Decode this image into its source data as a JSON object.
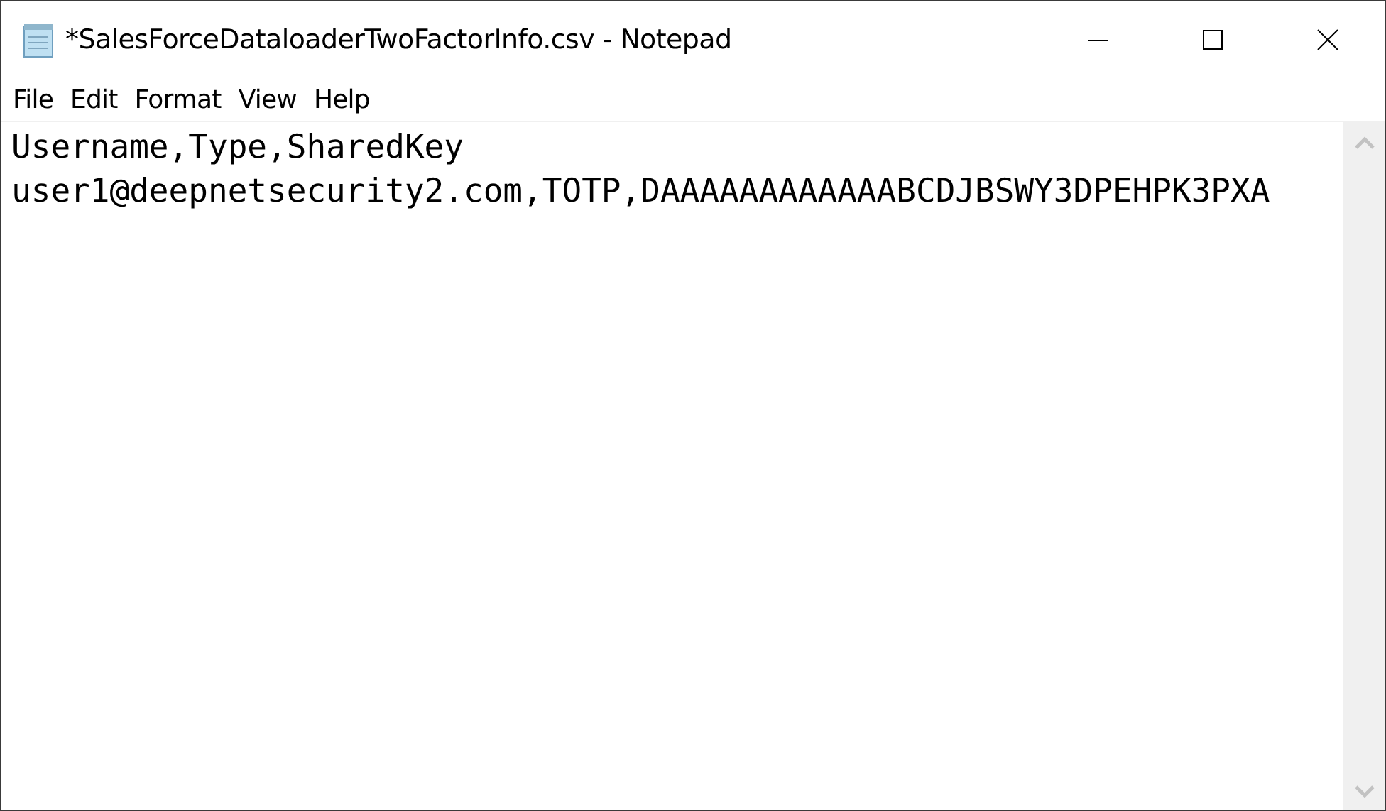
{
  "window": {
    "title": "*SalesForceDataloaderTwoFactorInfo.csv - Notepad"
  },
  "menu": [
    {
      "label": "File"
    },
    {
      "label": "Edit"
    },
    {
      "label": "Format"
    },
    {
      "label": "View"
    },
    {
      "label": "Help"
    }
  ],
  "editor": {
    "lines": [
      "Username,Type,SharedKey",
      "user1@deepnetsecurity2.com,TOTP,DAAAAAAAAAAAABCDJBSWY3DPEHPK3PXA"
    ]
  }
}
